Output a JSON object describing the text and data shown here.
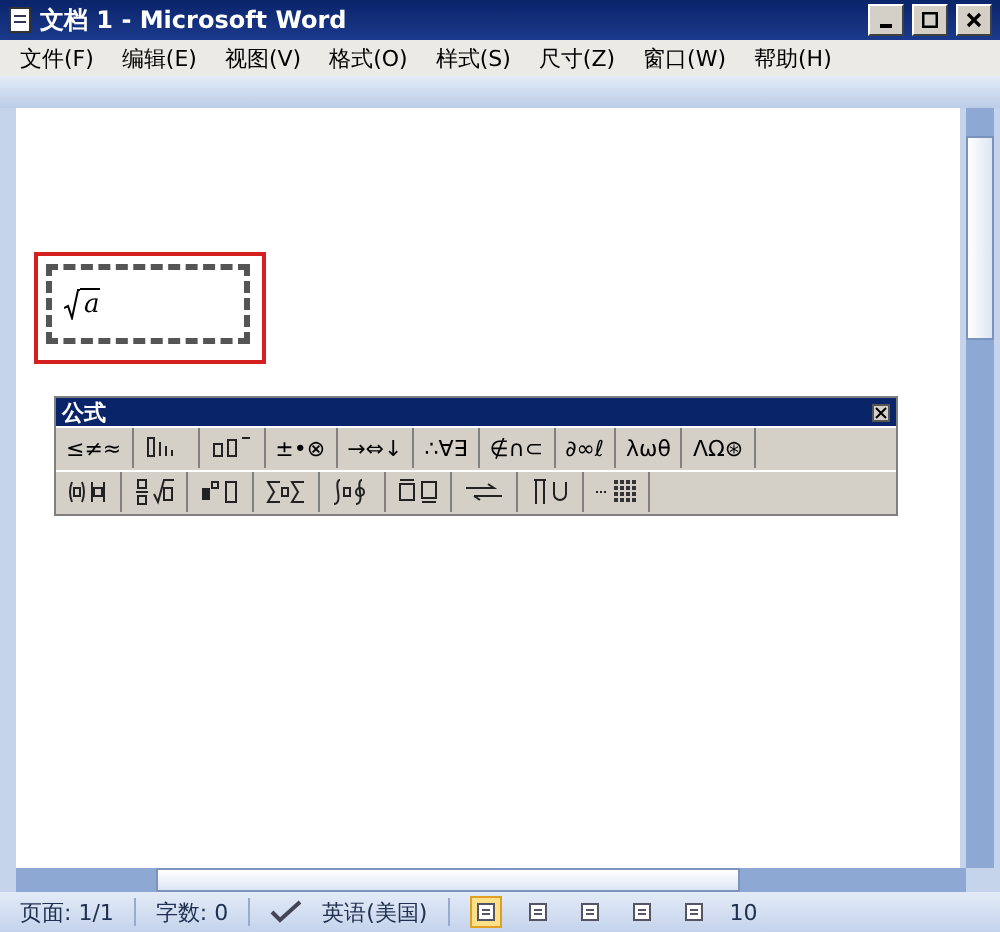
{
  "window": {
    "title": "文档 1 - Microsoft Word"
  },
  "menu": [
    "文件(F)",
    "编辑(E)",
    "视图(V)",
    "格式(O)",
    "样式(S)",
    "尺寸(Z)",
    "窗口(W)",
    "帮助(H)"
  ],
  "equation": {
    "text": "a"
  },
  "palette": {
    "title": "公式",
    "rows": [
      [
        {
          "kind": "text",
          "label": "≤≠≈"
        },
        {
          "kind": "icon"
        },
        {
          "kind": "icon"
        },
        {
          "kind": "text",
          "label": "±•⊗"
        },
        {
          "kind": "text",
          "label": "→⇔↓"
        },
        {
          "kind": "text",
          "label": "∴∀∃"
        },
        {
          "kind": "text",
          "label": "∉∩⊂"
        },
        {
          "kind": "text",
          "label": "∂∞ℓ"
        },
        {
          "kind": "text",
          "label": "λωθ"
        },
        {
          "kind": "text",
          "label": "ΛΩ⊛"
        }
      ],
      [
        {
          "kind": "icon"
        },
        {
          "kind": "icon"
        },
        {
          "kind": "icon"
        },
        {
          "kind": "icon"
        },
        {
          "kind": "icon"
        },
        {
          "kind": "icon"
        },
        {
          "kind": "icon"
        },
        {
          "kind": "icon"
        },
        {
          "kind": "icon"
        }
      ]
    ]
  },
  "status_bar": {
    "page": "页面: 1/1",
    "words": "字数: 0",
    "language": "英语(美国)",
    "views": [
      {
        "selected": true
      },
      {
        "selected": false
      },
      {
        "selected": false
      },
      {
        "selected": false
      },
      {
        "selected": false
      }
    ],
    "zoom": "10"
  }
}
